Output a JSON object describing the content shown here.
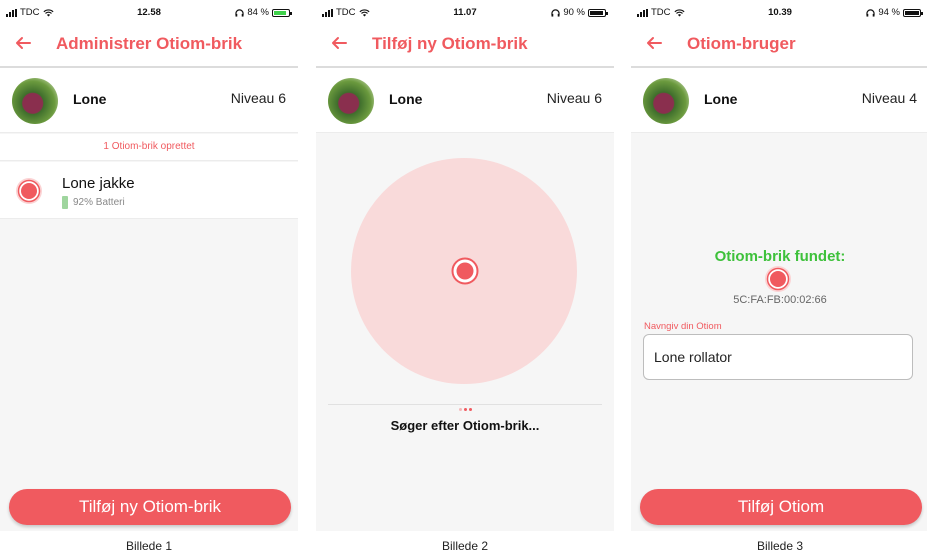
{
  "status_bars": [
    {
      "carrier": "TDC",
      "time": "12.58",
      "battery": "84 %",
      "battery_level": 0.84,
      "charging": true
    },
    {
      "carrier": "TDC",
      "time": "11.07",
      "battery": "90 %",
      "battery_level": 0.9,
      "charging": false
    },
    {
      "carrier": "TDC",
      "time": "10.39",
      "battery": "94 %",
      "battery_level": 0.94,
      "charging": false
    }
  ],
  "screen1": {
    "title": "Administrer Otiom-brik",
    "user": {
      "name": "Lone",
      "level": "Niveau 6"
    },
    "info": "1 Otiom-brik oprettet",
    "device": {
      "name": "Lone jakke",
      "battery": "92% Batteri",
      "battery_level": 0.92
    },
    "button": "Tilføj ny Otiom-brik",
    "caption": "Billede 1"
  },
  "screen2": {
    "title": "Tilføj ny Otiom-brik",
    "user": {
      "name": "Lone",
      "level": "Niveau 6"
    },
    "searching": "Søger efter Otiom-brik...",
    "caption": "Billede 2"
  },
  "screen3": {
    "title": "Otiom-bruger",
    "user": {
      "name": "Lone",
      "level": "Niveau 4"
    },
    "found_title": "Otiom-brik fundet:",
    "mac": "5C:FA:FB:00:02:66",
    "name_label": "Navngiv din Otiom",
    "name_value": "Lone rollator",
    "button": "Tilføj Otiom",
    "caption": "Billede 3"
  },
  "colors": {
    "accent": "#f05a5f",
    "found": "#3ec13b",
    "scan_circle": "#f9dada"
  },
  "icons": [
    "back-arrow-icon",
    "signal-icon",
    "wifi-icon",
    "headphones-icon",
    "battery-icon",
    "otiom-target-icon"
  ]
}
